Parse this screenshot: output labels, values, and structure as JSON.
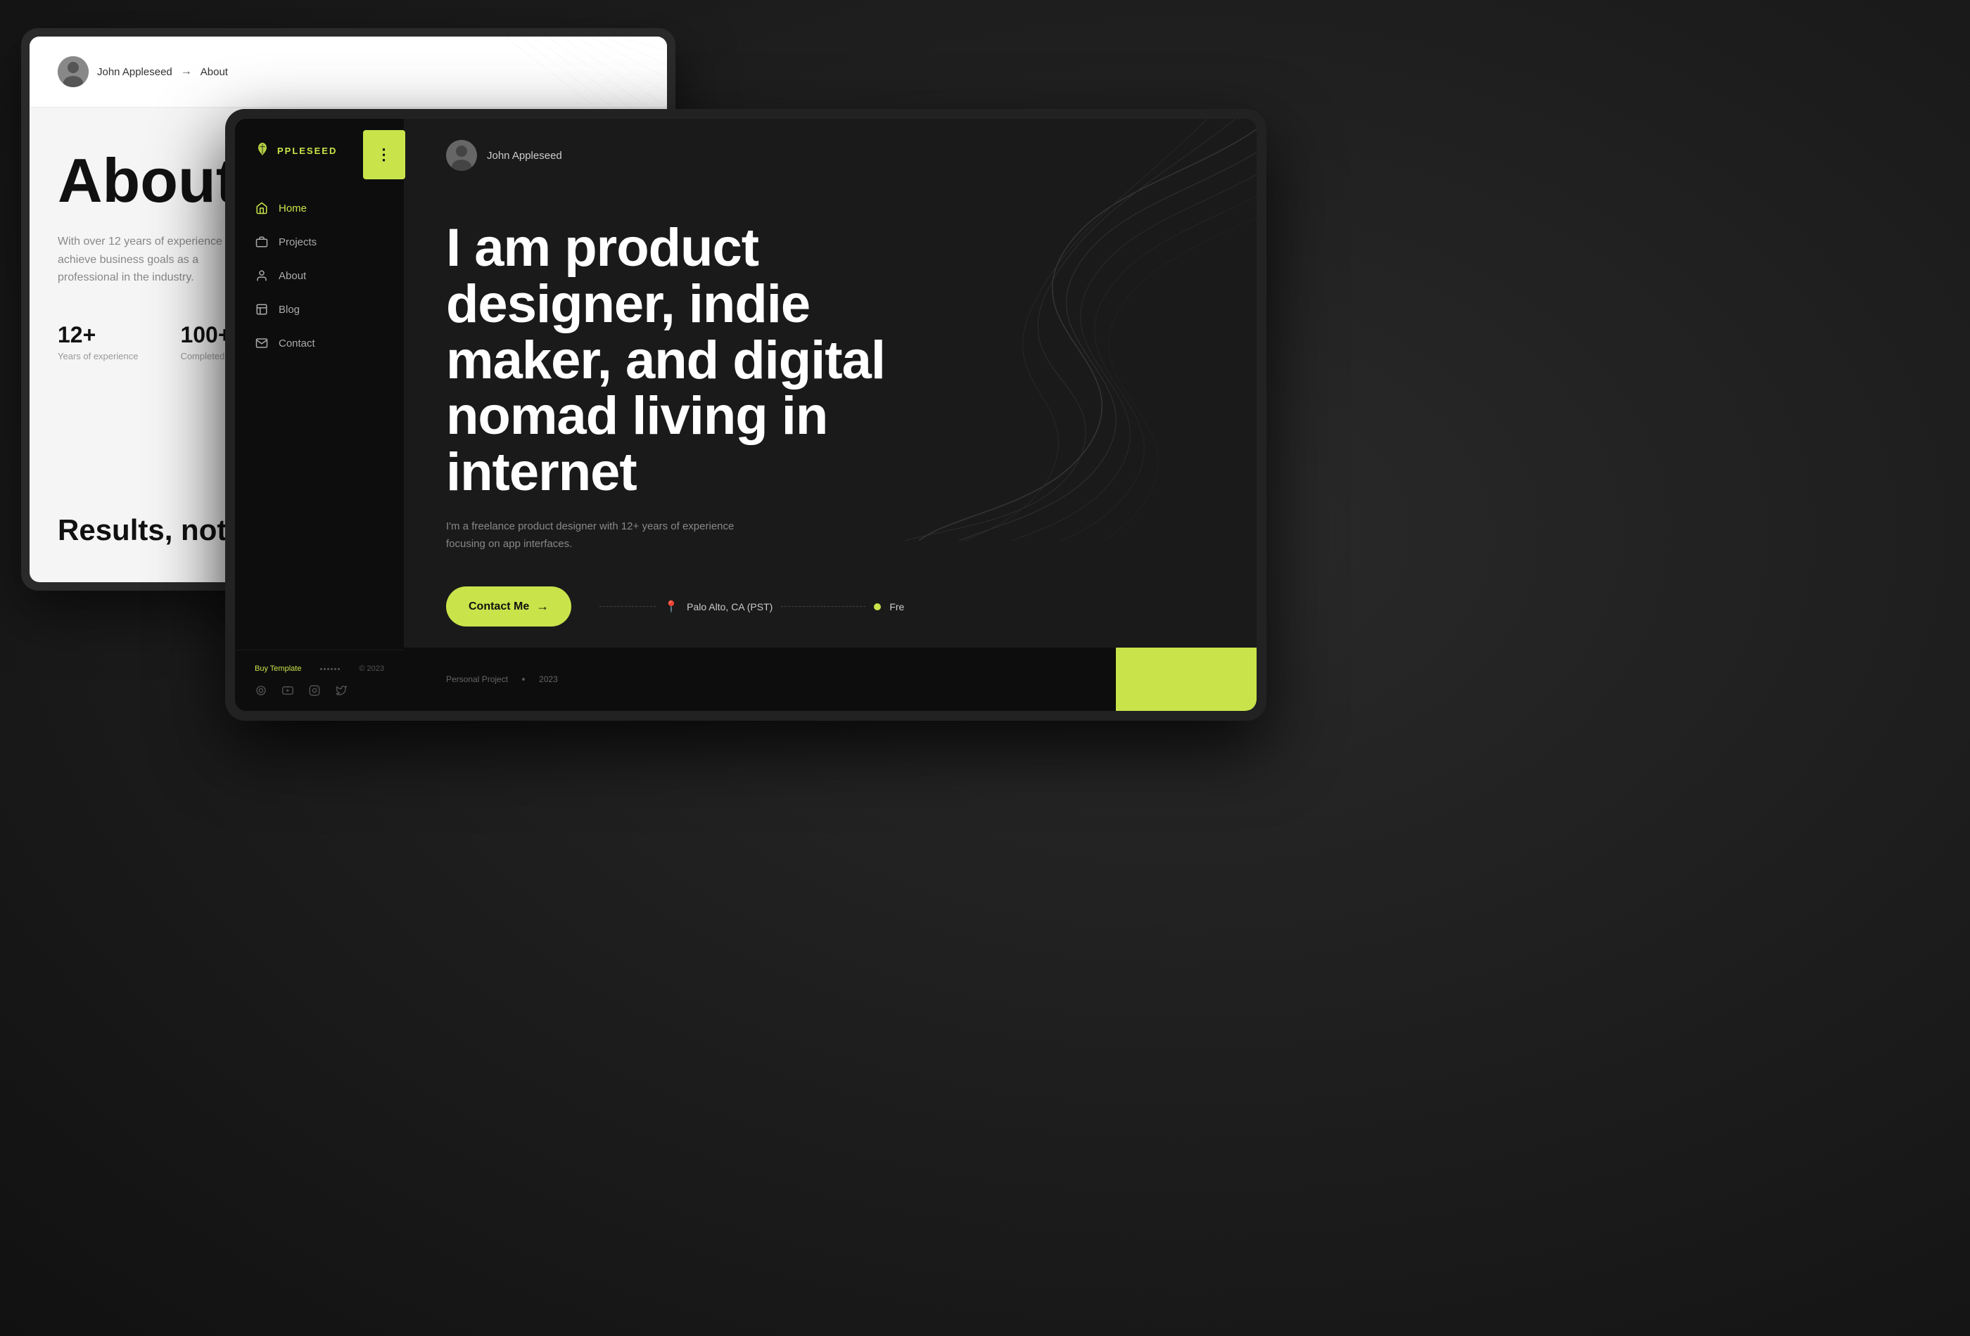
{
  "background": {
    "color": "#1a1a1a"
  },
  "device_back": {
    "header": {
      "avatar_alt": "John Appleseed avatar",
      "user_name": "John Appleseed",
      "arrow": "→",
      "page": "About"
    },
    "content": {
      "page_title": "About",
      "description": "With over 12 years of experience to achieve business goals as a professional in the industry.",
      "stats": [
        {
          "number": "12+",
          "label": "Years of experience"
        },
        {
          "number": "100+",
          "label": "Completed projects"
        }
      ],
      "bottom_tagline": "Results, not pixels"
    }
  },
  "device_front": {
    "sidebar": {
      "logo_icon": "🌿",
      "logo_text": "PPLESEED",
      "menu_button_icon": "⋮",
      "nav_items": [
        {
          "id": "home",
          "label": "Home",
          "icon": "home",
          "active": true
        },
        {
          "id": "projects",
          "label": "Projects",
          "icon": "briefcase",
          "active": false
        },
        {
          "id": "about",
          "label": "About",
          "icon": "user",
          "active": false
        },
        {
          "id": "blog",
          "label": "Blog",
          "icon": "book",
          "active": false
        },
        {
          "id": "contact",
          "label": "Contact",
          "icon": "envelope",
          "active": false
        }
      ],
      "footer": {
        "buy_link": "Buy Template",
        "copyright": "© 2023",
        "social_icons": [
          "instagram-circle",
          "youtube",
          "instagram",
          "twitter"
        ]
      }
    },
    "main": {
      "topbar": {
        "user_name": "John Appleseed"
      },
      "hero": {
        "headline": "I am product designer, indie maker, and digital nomad living in internet",
        "subtext": "I'm a freelance product designer with 12+ years of experience focusing on app interfaces.",
        "cta_button": "Contact Me",
        "cta_arrow": "→",
        "location": "Palo Alto, CA (PST)",
        "status_label": "Fre"
      },
      "bottom_strip": {
        "tag": "Personal Project",
        "dot": "•",
        "year": "2023"
      }
    }
  }
}
